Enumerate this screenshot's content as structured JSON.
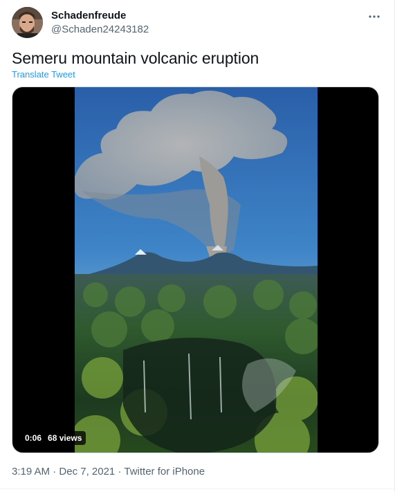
{
  "author": {
    "display_name": "Schadenfreude",
    "handle": "@Schaden24243182",
    "avatar_icon": "profile-photo"
  },
  "menu": {
    "more_icon": "more-dots-icon"
  },
  "tweet": {
    "text": "Semeru mountain volcanic eruption",
    "translate_label": "Translate Tweet"
  },
  "video": {
    "duration": "0:06",
    "views": "68 views"
  },
  "meta": {
    "time": "3:19 AM",
    "separator": "·",
    "date": "Dec 7, 2021",
    "source": "Twitter for iPhone"
  },
  "colors": {
    "link": "#1d9bf0",
    "secondary_text": "#536471",
    "primary_text": "#0f1419"
  }
}
